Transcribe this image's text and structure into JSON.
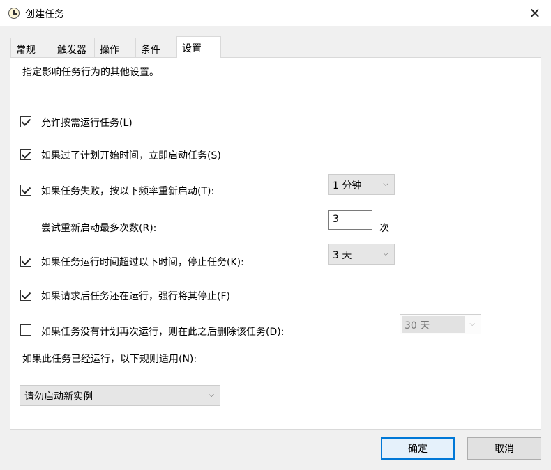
{
  "window": {
    "title": "创建任务",
    "close_glyph": "✕"
  },
  "tabs": [
    "常规",
    "触发器",
    "操作",
    "条件",
    "设置"
  ],
  "settings": {
    "description": "指定影响任务行为的其他设置。",
    "allow_on_demand": {
      "label": "允许按需运行任务(L)",
      "checked": true
    },
    "run_asap_missed": {
      "label": "如果过了计划开始时间，立即启动任务(S)",
      "checked": true
    },
    "restart_on_fail": {
      "label": "如果任务失败，按以下频率重新启动(T):",
      "checked": true,
      "interval": "1 分钟"
    },
    "retry_attempts": {
      "label": "尝试重新启动最多次数(R):",
      "value": "3",
      "unit": "次"
    },
    "stop_if_runs_longer": {
      "label": "如果任务运行时间超过以下时间，停止任务(K):",
      "checked": true,
      "duration": "3 天"
    },
    "force_stop": {
      "label": "如果请求后任务还在运行，强行将其停止(F)",
      "checked": true
    },
    "delete_if_not_scheduled": {
      "label": "如果任务没有计划再次运行，则在此之后删除该任务(D):",
      "checked": false,
      "after": "30 天"
    },
    "running_rule_label": "如果此任务已经运行，以下规则适用(N):",
    "running_rule_value": "请勿启动新实例"
  },
  "buttons": {
    "ok": "确定",
    "cancel": "取消"
  }
}
